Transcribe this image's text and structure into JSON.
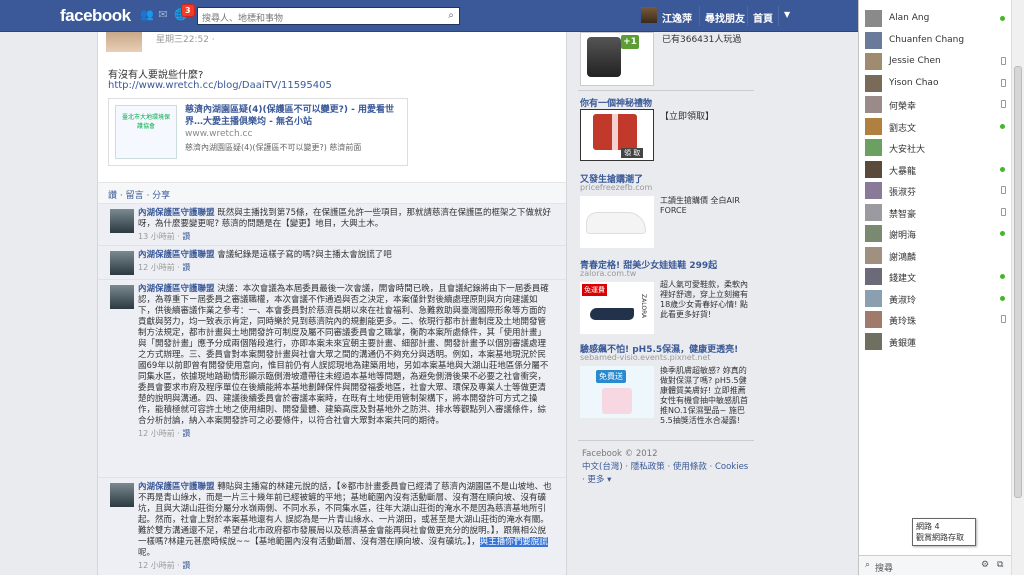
{
  "topbar": {
    "logo": "facebook",
    "notif_count": "3",
    "search_placeholder": "搜尋人、地標和事物",
    "user_name": "江逸萍",
    "find_friends": "尋找朋友",
    "home": "首頁"
  },
  "post": {
    "time": "星期三22:52 · ",
    "text": "有沒有人要說些什麼?",
    "link": "http://www.wretch.cc/blog/DaaiTV/11595405",
    "preview": {
      "thumb_text": "臺北市大地環境保護協會",
      "title": "慈濟內湖園區疑(4)(保護區不可以變更?) - 用愛看世界…大愛主播俱樂均 - 無名小站",
      "domain": "www.wretch.cc",
      "desc": "慈濟內湖園區疑(4)(保護區不可以變更?) 慈濟前面"
    },
    "actions": "讚 · 留言 · 分享"
  },
  "comments": [
    {
      "author": "內湖保護區守護聯盟",
      "text": "既然與主播找到第75條，在保護區允許一些項目，那就請慈濟在保護區的框架之下做就好呀，為什麼要變更呢? 慈濟的問題是在【變更】地目，大興土木。",
      "time": "13 小時前",
      "like": "讚"
    },
    {
      "author": "內湖保護區守護聯盟",
      "text": "會議紀錄是這樣子寫的嗎?與主播太會說謊了吧",
      "time": "12 小時前",
      "like": "讚"
    },
    {
      "author": "內湖保護區守護聯盟",
      "text": "決議：本次會議為本屆委員最後一次會議，開會時間已晚，且會議紀錄將由下一屆委員確認，為尊重下ㄧ屆委員之審議職權，本次會議不作通過與否之決定，本案僅針對後續處理原則與方向建議如下，供後續審議作業之參考：一、本會委員對於慈濟長期以來在社會福利、急難救助與臺灣國際形象等方面的貢獻與努力，均一致表示肯定，同時樂於見到慈濟院內的規劃能更多。二、依現行都市計畫制度及土地開發管制方法規定，都市計畫與土地開發許可制度及屬不同審議委員會之職掌，衡酌本案所處條件，其「使用計畫」與「開發計畫」應予分成兩個階段進行，亦即本案未來宜朝主要計畫、細部計畫、開發計畫予以個別審議處理之方式辦理。三、委員會對本案開發計畫與社會大眾之間的溝通仍不夠充分與透明。例如，本案基地現況於民國69年以前即曾有開發使用意向，惟目前仍有人誤認現地為建築用地，另如本案基地與大湖山莊地區係分屬不同集水區，依據現地踏勘情形顯示臨側滑坡遭帶往未經過本基地等問題，為避免側滑後果不必要之社會衝突，委員會要求市府及程序單位在後續能將本基地劃歸保件與開發福委地區，社會大眾、環保及專業人士等做更清楚的說明與溝通。四、建議後續委員會於審議本案時，在既有土地使用管制架構下，將本開發許可方式之操作，能積極就可容許土地之使用細則、開發量體、建築高度及對基地外之防洪、排水等觀點列入審議條件，綜合分析討論，納入本案開發許可之必要條件，以符合社會大眾對本案共同的期待。",
      "time": "12 小時前",
      "like": "讚"
    },
    {
      "author": "內湖保護區守護聯盟",
      "text": "轉貼與主播寫的林建元說的話，【※都市計畫委員會已經清了慈濟內湖園區不是山坡地、也不再是青山綠水，而是一片三十幾年前已經被鏟的平地；基地範圍內沒有活動斷層、沒有潛在順向坡、沒有礦坑，且與大湖山莊街分屬分水嶺兩側、不同水系，不同集水區，往年大湖山莊街的淹水不是因為慈濟基地所引起。然而，社會上對於本案基地還有人 誤認為是一片青山綠水、一片湖田，或甚至是大湖山莊街的淹水有關。難於雙方溝通還不足，希望台北市政府都市發展局以及慈濟基金會能再與社會做更充分的說明。】，跟無相公說一樣嗎?林建元甚麼時候說~~【基地範圍內沒有活動斷層、沒有潛在順向坡、沒有礦坑。】，",
      "highlight": "與主播你們要說謊",
      "tail": "呢。",
      "time": "12 小時前",
      "like": "讚"
    }
  ],
  "right_column": {
    "psy_count": "已有366431人玩過",
    "gift_title": "你有一個神秘禮物",
    "gift_claim": "【立即領取】",
    "gift_btn": "領 取",
    "ad2": {
      "title": "又發生搶購潮了",
      "sub": "pricefreezefb.com",
      "text": "工讀生搶購價 全白AIR FORCE"
    },
    "ad3": {
      "title": "青春定格! 甜美少女娃娃鞋 299起",
      "sub": "zalora.com.tw",
      "badge": "免運費",
      "brand": "ZALORA",
      "text": "超人氣可愛鞋款，柔軟內裡好舒適，穿上立刻擁有18歲少女青春好心情! 點此看更多好貨!"
    },
    "ad4": {
      "title": "驗感飆不怕! pH5.5保濕，健康更透亮!",
      "sub": "sebamed-visio.events.pixnet.net",
      "free": "免費送",
      "text": "換季肌膚超敏感? 妳真的做對保濕了嗎? pH5.5健康體質美膚好! 立即推薦女性有機會抽中敏感肌首推NO.1保濕聖品~ 施巴5.5抽獎活性水合凝露!"
    },
    "footer": {
      "copyright": "Facebook © 2012",
      "links": "中文(台灣) · 隱私政策 · 使用條款 · Cookies",
      "more": "· 更多 ▾"
    }
  },
  "chat": {
    "friends": [
      {
        "name": "Alan Ang",
        "status": "online"
      },
      {
        "name": "Chuanfen Chang",
        "status": "none"
      },
      {
        "name": "Jessie Chen",
        "status": "mobile"
      },
      {
        "name": "Yison Chao",
        "status": "mobile"
      },
      {
        "name": "何榮幸",
        "status": "mobile"
      },
      {
        "name": "劉志文",
        "status": "online"
      },
      {
        "name": "大安社大",
        "status": "none"
      },
      {
        "name": "大暴龍",
        "status": "online"
      },
      {
        "name": "張淑芬",
        "status": "mobile"
      },
      {
        "name": "禁智豪",
        "status": "mobile"
      },
      {
        "name": "謝明海",
        "status": "online"
      },
      {
        "name": "謝鴻麟",
        "status": "none"
      },
      {
        "name": "錢建文",
        "status": "online"
      },
      {
        "name": "黃淑玲",
        "status": "online"
      },
      {
        "name": "黃玲珠",
        "status": "mobile"
      },
      {
        "name": "黃銀蓮",
        "status": "none"
      }
    ],
    "search": "搜尋",
    "tooltip_line1": "網路 4",
    "tooltip_line2": "觀賞網路存取"
  }
}
